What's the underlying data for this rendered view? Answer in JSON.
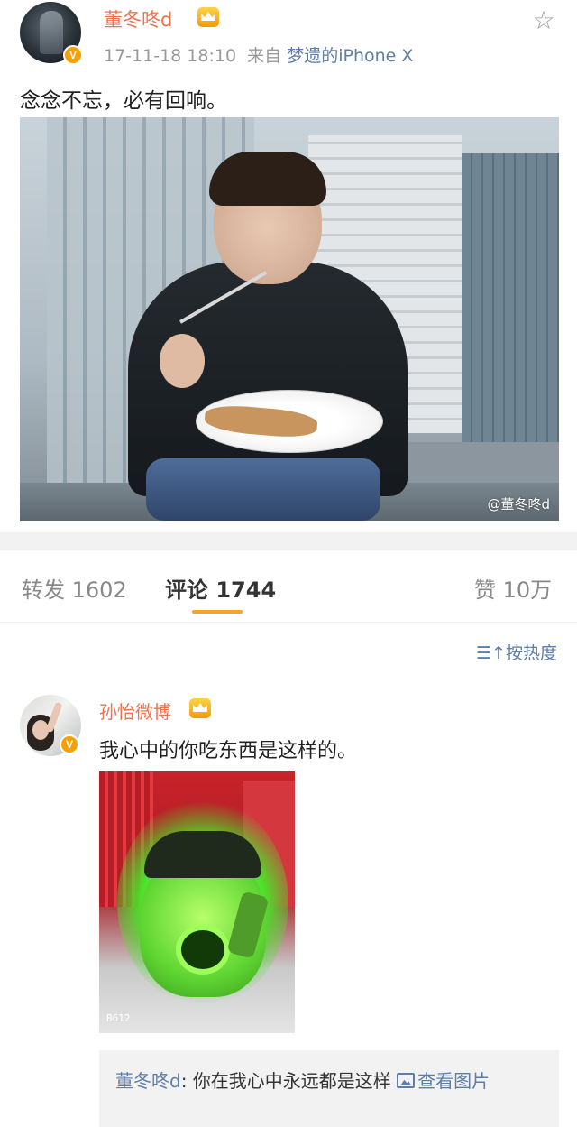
{
  "post": {
    "username": "董冬咚d",
    "vip_badge": "V",
    "timestamp": "17-11-18 18:10",
    "source_prefix": "来自",
    "source": "梦遗的iPhone X",
    "text": "念念不忘，必有回响。",
    "photo_watermark": "@董冬咚d",
    "favorite_icon": "star-outline-icon"
  },
  "tabs": [
    {
      "label": "转发",
      "count": "1602"
    },
    {
      "label": "评论",
      "count": "1744",
      "active": true
    },
    {
      "label": "赞",
      "count": "10万"
    }
  ],
  "sort": {
    "label": "按热度",
    "icon": "sort-icon"
  },
  "comment": {
    "username": "孙怡微博",
    "vip_badge": "V",
    "text": "我心中的你吃东西是这样的。",
    "image_watermark": "B612",
    "reply": {
      "author": "董冬咚d",
      "separator": ":",
      "text": "你在我心中永远都是这样",
      "link_label": "查看图片",
      "link_icon": "image-icon"
    }
  },
  "colors": {
    "username": "#eb7350",
    "link": "#5d7ea8",
    "tab_indicator": "#f6a623",
    "vip_badge": "#f7a000"
  }
}
